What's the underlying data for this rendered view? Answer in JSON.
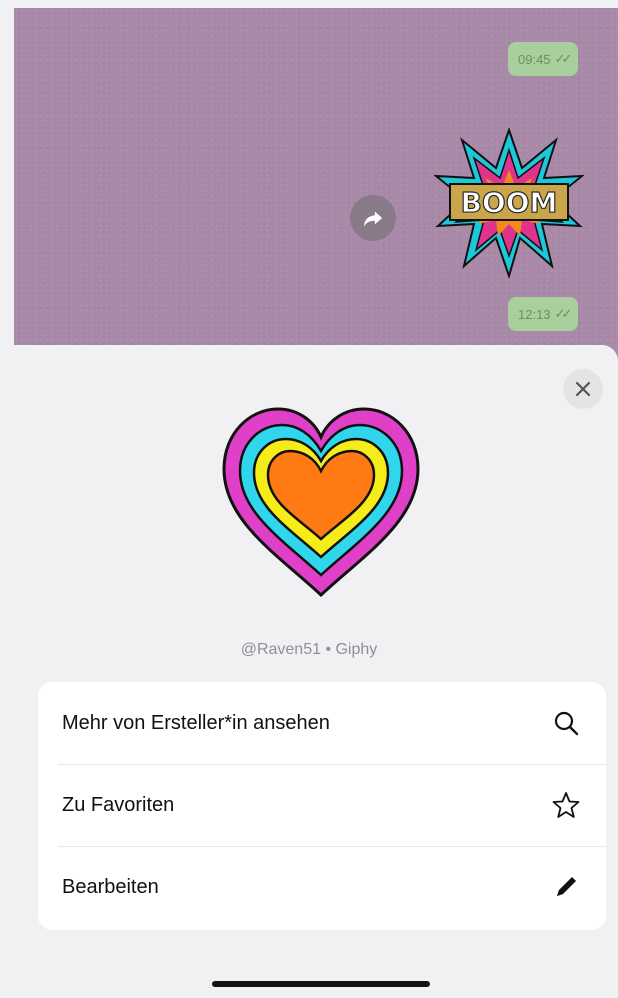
{
  "chat": {
    "messages": [
      {
        "time": "09:45",
        "status": "read"
      },
      {
        "time": "12:13",
        "status": "read"
      }
    ],
    "sticker_boom_text": "BOOM",
    "forward_icon": "forward-icon"
  },
  "sheet": {
    "close_icon": "close-icon",
    "sticker": "rainbow-heart-sticker",
    "attribution": "@Raven51 • Giphy",
    "menu": [
      {
        "label": "Mehr von Ersteller*in ansehen",
        "icon": "search-icon"
      },
      {
        "label": "Zu Favoriten",
        "icon": "star-icon"
      },
      {
        "label": "Bearbeiten",
        "icon": "pencil-icon"
      }
    ]
  },
  "colors": {
    "chat_background": "#a88aa8",
    "time_bubble": "#a9cf9d",
    "sheet_background": "#f1f1f3"
  }
}
